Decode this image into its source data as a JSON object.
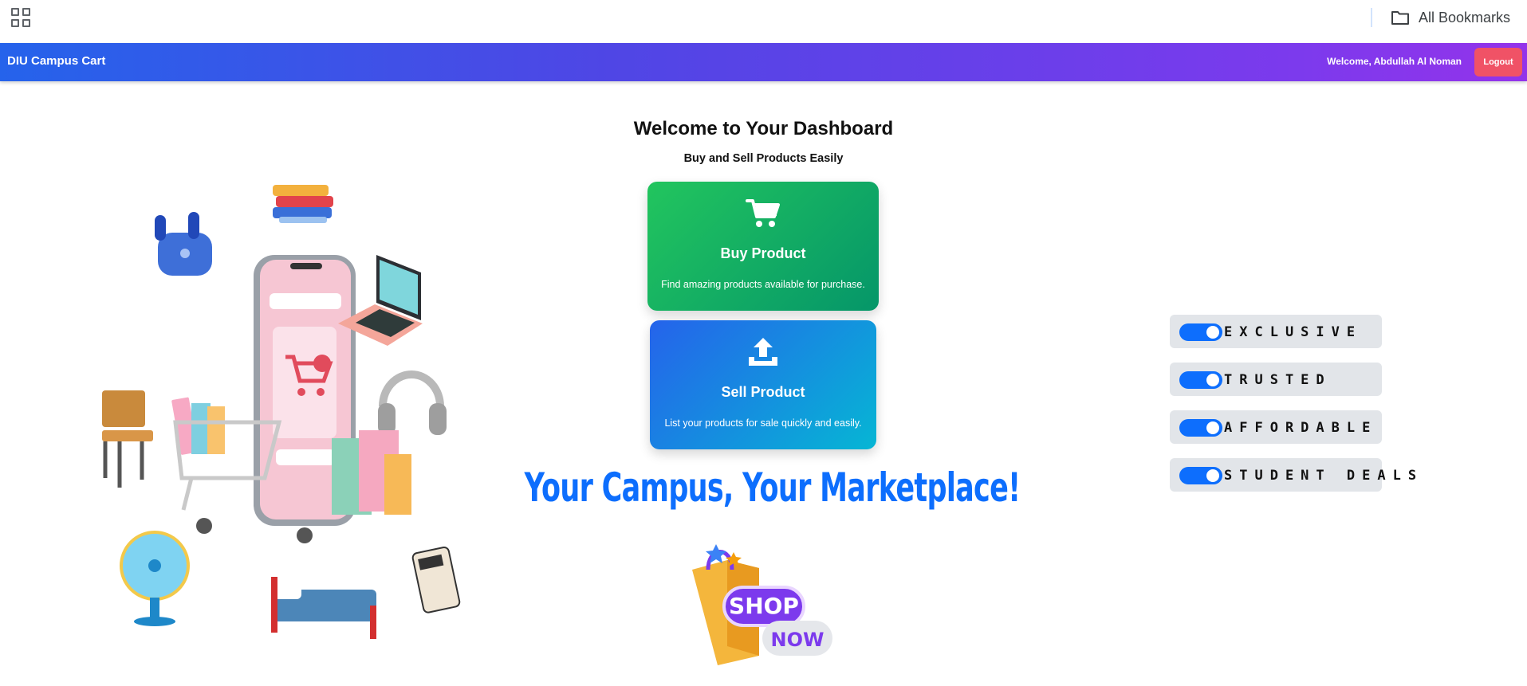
{
  "bookmarks_bar": {
    "all_bookmarks_label": "All Bookmarks"
  },
  "navbar": {
    "brand": "DIU Campus Cart",
    "welcome_text": "Welcome, Abdullah Al Noman",
    "logout_label": "Logout",
    "gradient_start": "#2563eb",
    "gradient_end": "#9333ea"
  },
  "dashboard": {
    "title": "Welcome to Your Dashboard",
    "subtitle": "Buy and Sell Products Easily"
  },
  "cards": {
    "buy": {
      "icon": "shopping-cart-icon",
      "title": "Buy Product",
      "description": "Find amazing products available for purchase.",
      "color": "#16a34a"
    },
    "sell": {
      "icon": "upload-icon",
      "title": "Sell Product",
      "description": "List your products for sale quickly and easily.",
      "color": "#2563eb"
    }
  },
  "slogan": "Your Campus, Your Marketplace!",
  "features": [
    {
      "label": "EXCLUSIVE",
      "enabled": true
    },
    {
      "label": "TRUSTED",
      "enabled": true
    },
    {
      "label": "AFFORDABLE",
      "enabled": true
    },
    {
      "label": "STUDENT DEALS",
      "enabled": true
    }
  ],
  "shop_badge": {
    "line1": "SHOP",
    "line2": "NOW"
  },
  "colors": {
    "accent_blue": "#0d6efd",
    "logout_red": "#f05266"
  }
}
